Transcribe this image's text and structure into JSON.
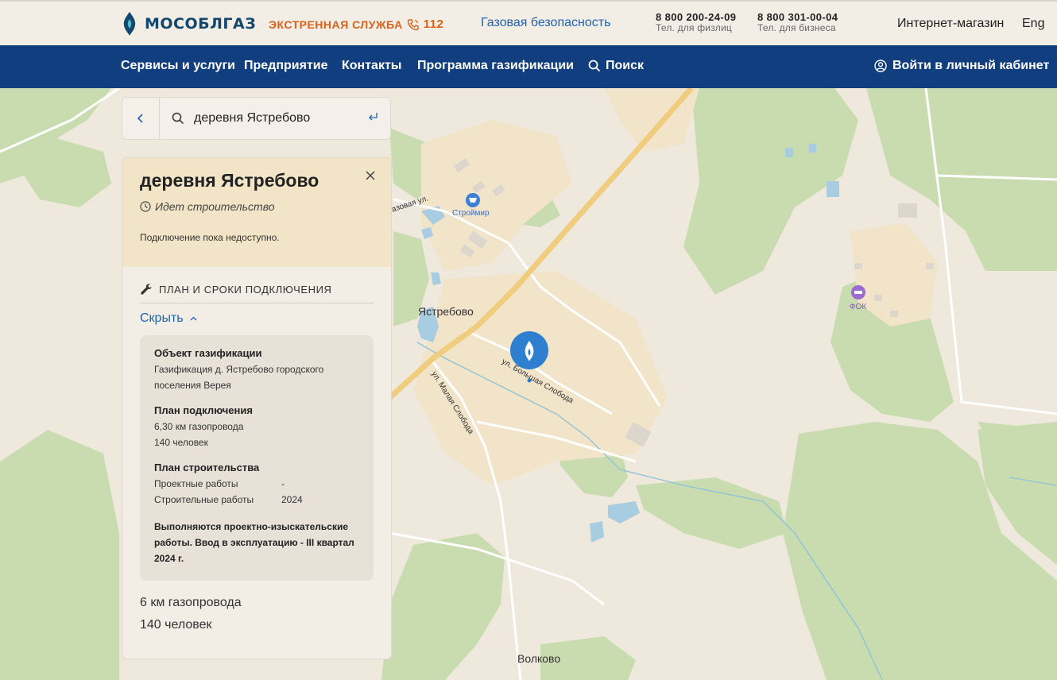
{
  "header": {
    "logo_text": "МОСОБЛГАЗ",
    "emergency_label": "ЭКСТРЕННАЯ СЛУЖБА",
    "emergency_number": "112",
    "gas_safety": "Газовая безопасность",
    "phones": [
      {
        "number": "8 800 200-24-09",
        "caption": "Тел. для физлиц"
      },
      {
        "number": "8 800 301-00-04",
        "caption": "Тел. для бизнеса"
      }
    ],
    "shop": "Интернет-магазин",
    "lang": "Eng"
  },
  "nav": {
    "items": [
      "Сервисы и услуги",
      "Предприятие",
      "Контакты",
      "Программа газификации"
    ],
    "search": "Поиск",
    "login": "Войти в личный кабинет"
  },
  "search": {
    "value": "деревня Ястребово"
  },
  "panel": {
    "title": "деревня Ястребово",
    "status": "Идет строительство",
    "note": "Подключение пока недоступно.",
    "plan_header": "ПЛАН И СРОКИ ПОДКЛЮЧЕНИЯ",
    "hide_link": "Скрыть",
    "object_head": "Объект газификации",
    "object_text": "Газификация д. Ястребово городского поселения Верея",
    "connection_head": "План подключения",
    "connection_lines": [
      "6,30 км газопровода",
      "140 человек"
    ],
    "construction_head": "План строительства",
    "construction_rows": [
      {
        "key": "Проектные работы",
        "value": "-"
      },
      {
        "key": "Строительные работы",
        "value": "2024"
      }
    ],
    "final_note": "Выполняются проектно-изыскательские работы. Ввод в эксплуатацию - III квартал 2024 г.",
    "summary": [
      "6 км газопровода",
      "140 человек"
    ]
  },
  "map": {
    "labels": {
      "village": "Ястребово",
      "volkovo": "Волково",
      "store": "Строймир",
      "fok": "ФОК",
      "street_top": "Базовая ул.",
      "street_big": "ул. Большая Слобода",
      "street_small": "ул. Малая Слобода"
    }
  },
  "colors": {
    "nav_bg": "#103e7f",
    "accent_blue": "#1e63b2",
    "emergency_orange": "#d9621a",
    "panel_head_bg": "#f2e4c7"
  }
}
